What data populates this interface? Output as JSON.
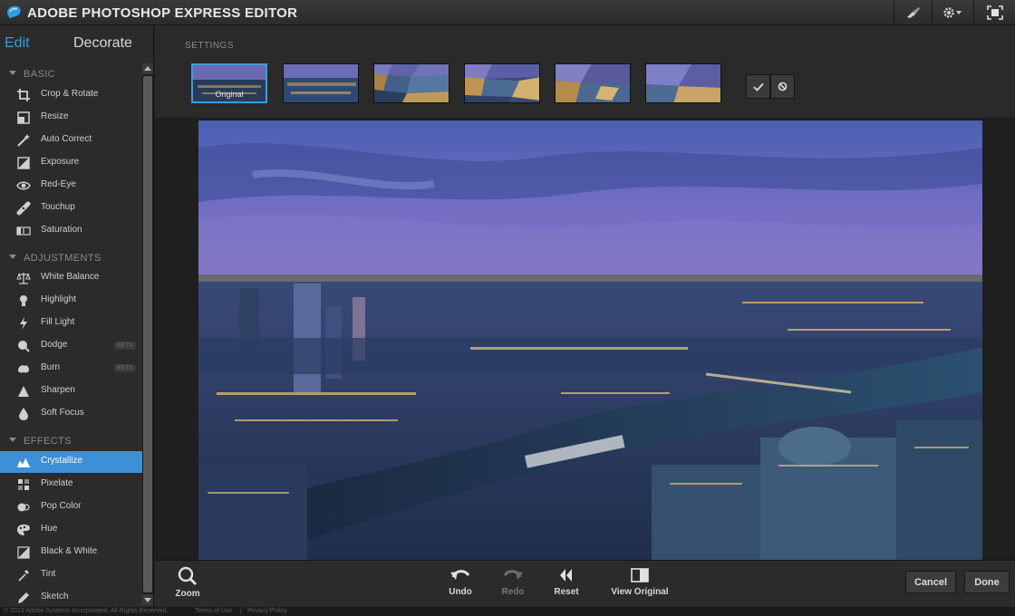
{
  "app": {
    "title": "ADOBE PHOTOSHOP EXPRESS EDITOR"
  },
  "sidebar": {
    "tabs": {
      "edit": "Edit",
      "decorate": "Decorate"
    },
    "sections": {
      "basic": "BASIC",
      "adjustments": "ADJUSTMENTS",
      "effects": "EFFECTS"
    },
    "basic_items": [
      "Crop & Rotate",
      "Resize",
      "Auto Correct",
      "Exposure",
      "Red-Eye",
      "Touchup",
      "Saturation"
    ],
    "adjustment_items": [
      "White Balance",
      "Highlight",
      "Fill Light",
      "Dodge",
      "Burn",
      "Sharpen",
      "Soft Focus"
    ],
    "effect_items": [
      "Crystallize",
      "Pixelate",
      "Pop Color",
      "Hue",
      "Black & White",
      "Tint",
      "Sketch"
    ],
    "active_item": "Crystallize",
    "beta_label": "BETA"
  },
  "settings": {
    "label": "SETTINGS",
    "original_caption": "Original"
  },
  "bottombar": {
    "zoom": "Zoom",
    "undo": "Undo",
    "redo": "Redo",
    "reset": "Reset",
    "view_original": "View Original",
    "cancel": "Cancel",
    "done": "Done"
  },
  "footer": {
    "copyright": "© 2013 Adobe Systems Incorporated. All Rights Reserved.",
    "terms": "Terms of Use",
    "privacy": "Privacy Policy"
  },
  "colors": {
    "accent": "#3d9bdb",
    "active_row": "#3d8fd6"
  }
}
